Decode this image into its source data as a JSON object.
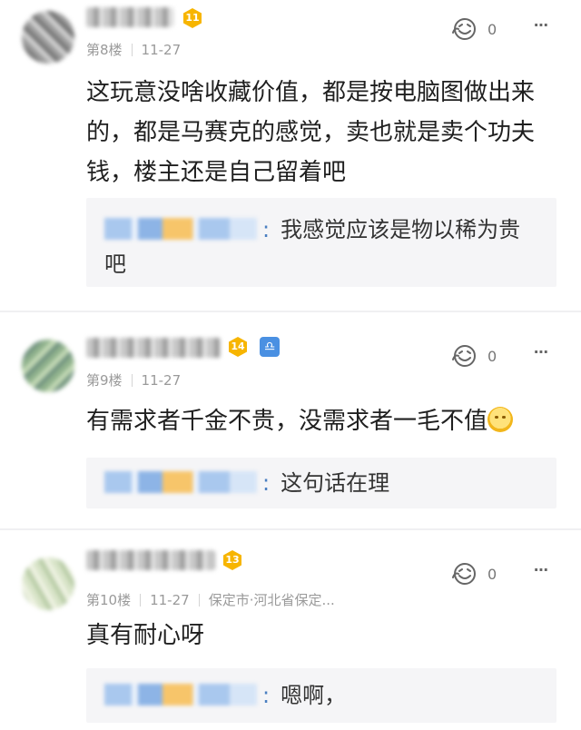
{
  "comments": [
    {
      "level": "11",
      "floor": "第8楼",
      "date": "11-27",
      "location": "",
      "likes": "0",
      "content": "这玩意没啥收藏价值，都是按电脑图做出来的，都是马赛克的感觉，卖也就是卖个功夫钱，楼主还是自己留着吧",
      "reply": {
        "colon": ":",
        "text": "我感觉应该是物以稀为贵吧"
      }
    },
    {
      "level": "14",
      "zodiac": "♎",
      "floor": "第9楼",
      "date": "11-27",
      "location": "",
      "likes": "0",
      "content": "有需求者千金不贵，没需求者一毛不值",
      "reply": {
        "colon": ":",
        "text": "这句话在理"
      }
    },
    {
      "level": "13",
      "floor": "第10楼",
      "date": "11-27",
      "location": "保定市·河北省保定...",
      "likes": "0",
      "content": "真有耐心呀",
      "reply": {
        "colon": ":",
        "text": "嗯啊，"
      }
    }
  ],
  "ui": {
    "more_glyph": "○○○",
    "level_color": "#f7b500",
    "zodiac_color": "#4a90e2",
    "reply_colon_color": "#4a7fc1"
  }
}
